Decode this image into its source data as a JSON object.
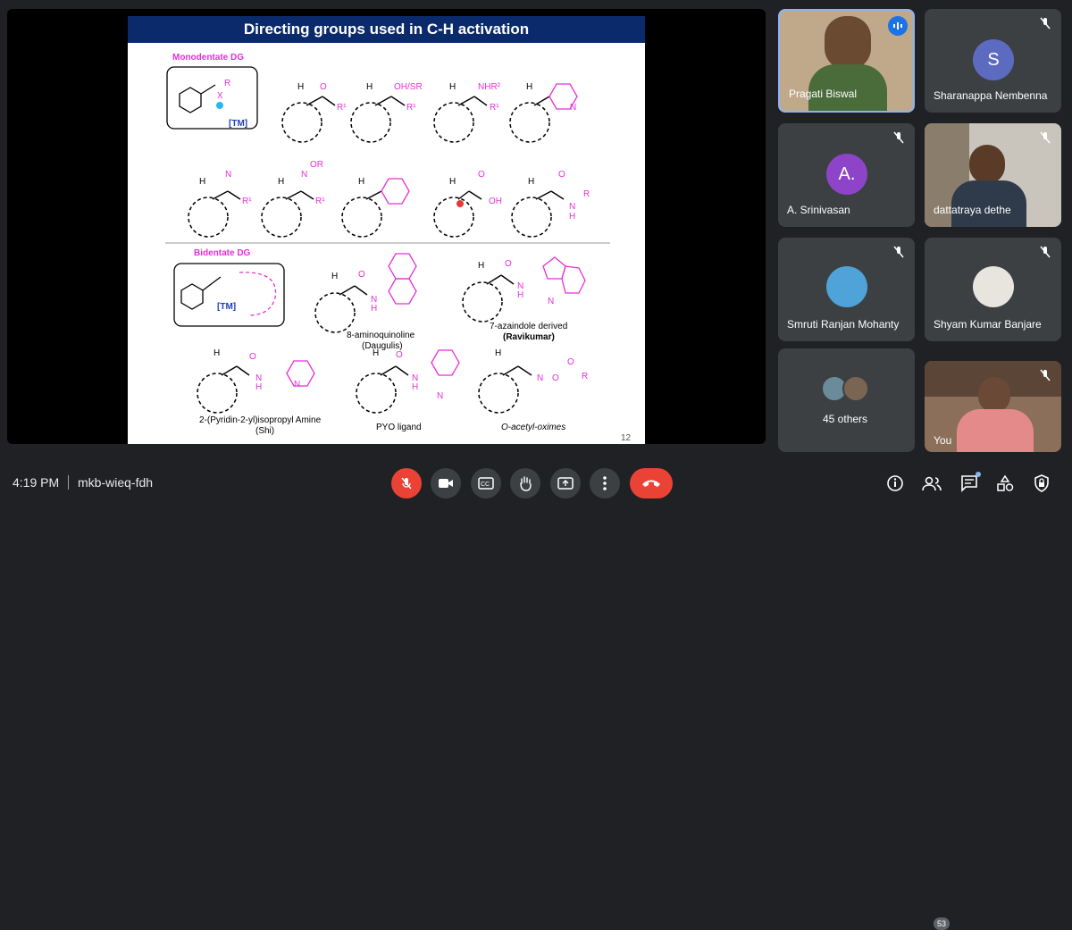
{
  "slide": {
    "title": "Directing groups used in C-H activation",
    "page_number": "12",
    "sections": {
      "monodentate": "Monodentate DG",
      "bidentate": "Bidentate DG"
    },
    "labels": {
      "tm": "[TM]",
      "aminoquinoline": "8-aminoquinoline",
      "daugulis": "(Daugulis)",
      "azaindole": "7-azaindole derived",
      "ravikumar": "(Ravikumar)",
      "pyridinyl": "2-(Pyridin-2-yl)isopropyl Amine",
      "shi": "(Shi)",
      "pyo": "PYO ligand",
      "oxime": "O-acetyl-oximes"
    }
  },
  "participants": [
    {
      "name": "Pragati Biswal",
      "speaking": true
    },
    {
      "name": "Sharanappa Nembenna",
      "initial": "S",
      "avatar_color": "#5c6bc0"
    },
    {
      "name": "A. Srinivasan",
      "initial": "A.",
      "avatar_color": "#8e44c9"
    },
    {
      "name": "dattatraya dethe"
    },
    {
      "name": "Smruti Ranjan Mohanty"
    },
    {
      "name": "Shyam Kumar Banjare"
    },
    {
      "name": "45 others"
    },
    {
      "name": "You"
    }
  ],
  "meeting": {
    "time": "4:19 PM",
    "code": "mkb-wieq-fdh",
    "participant_count": "53"
  },
  "icons": {
    "mic_off": "mic-off-icon",
    "camera": "camera-icon",
    "captions": "captions-icon",
    "raise_hand": "raise-hand-icon",
    "present": "present-icon",
    "more": "more-options-icon",
    "end_call": "end-call-icon",
    "info": "info-icon",
    "people": "people-icon",
    "chat": "chat-icon",
    "activities": "activities-icon",
    "host_controls": "host-controls-icon"
  }
}
